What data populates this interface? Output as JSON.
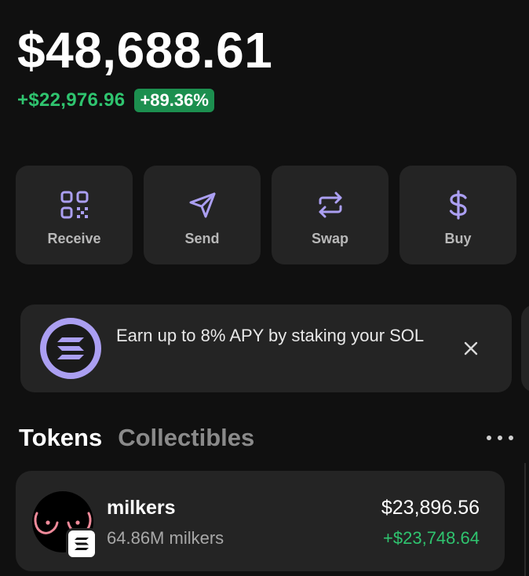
{
  "balance": {
    "total": "$48,688.61",
    "change_amount": "+$22,976.96",
    "change_percent": "+89.36%"
  },
  "actions": [
    {
      "label": "Receive",
      "icon": "qr-code-icon"
    },
    {
      "label": "Send",
      "icon": "send-arrow-icon"
    },
    {
      "label": "Swap",
      "icon": "swap-arrows-icon"
    },
    {
      "label": "Buy",
      "icon": "dollar-icon"
    }
  ],
  "promo": {
    "text": "Earn up to 8% APY by staking your SOL",
    "icon": "solana-logo-icon"
  },
  "tabs": [
    {
      "label": "Tokens",
      "active": true
    },
    {
      "label": "Collectibles",
      "active": false
    }
  ],
  "tokens": [
    {
      "name": "milkers",
      "balance": "64.86M milkers",
      "value": "$23,896.56",
      "change": "+$23,748.64"
    }
  ],
  "colors": {
    "accent": "#ab9ff2",
    "positive": "#2fc46f",
    "badge_bg": "#1c8f4f",
    "card_bg": "#242424",
    "page_bg": "#101010"
  }
}
